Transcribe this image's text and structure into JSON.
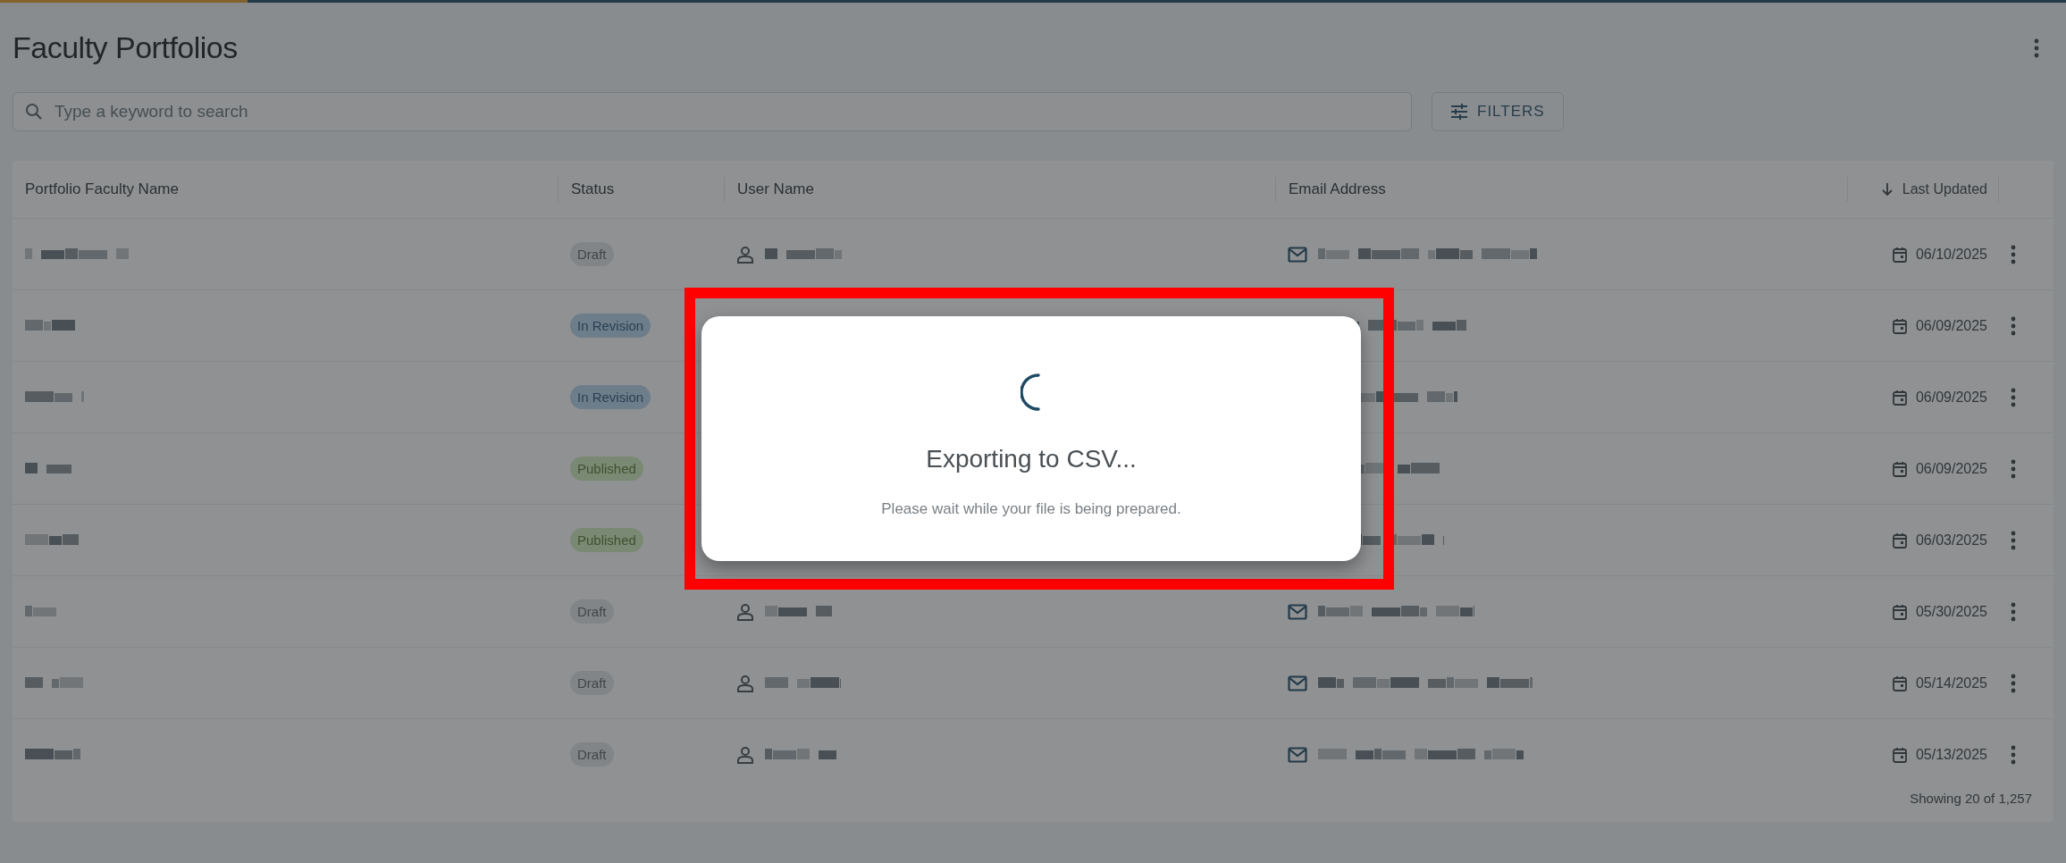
{
  "progress_bar": {
    "level": 0.12
  },
  "page": {
    "title": "Faculty Portfolios"
  },
  "search": {
    "placeholder": "Type a keyword to search"
  },
  "filters_button": {
    "label": "FILTERS"
  },
  "table": {
    "columns": [
      {
        "label": "Portfolio Faculty Name",
        "sorted": false
      },
      {
        "label": "Status",
        "sorted": false
      },
      {
        "label": "User Name",
        "sorted": false
      },
      {
        "label": "Email Address",
        "sorted": false
      },
      {
        "label": "Last Updated",
        "sorted": true
      }
    ],
    "rows": [
      {
        "status": {
          "label": "Draft",
          "kind": "draft"
        },
        "under_dialog": false,
        "last_updated": "06/10/2025"
      },
      {
        "status": {
          "label": "In Revision",
          "kind": "revision"
        },
        "under_dialog": true,
        "last_updated": "06/09/2025"
      },
      {
        "status": {
          "label": "In Revision",
          "kind": "revision"
        },
        "under_dialog": true,
        "last_updated": "06/09/2025"
      },
      {
        "status": {
          "label": "Published",
          "kind": "published"
        },
        "under_dialog": true,
        "last_updated": "06/09/2025"
      },
      {
        "status": {
          "label": "Published",
          "kind": "published"
        },
        "under_dialog": true,
        "last_updated": "06/03/2025"
      },
      {
        "status": {
          "label": "Draft",
          "kind": "draft"
        },
        "under_dialog": false,
        "last_updated": "05/30/2025"
      },
      {
        "status": {
          "label": "Draft",
          "kind": "draft"
        },
        "under_dialog": false,
        "last_updated": "05/14/2025"
      },
      {
        "status": {
          "label": "Draft",
          "kind": "draft"
        },
        "under_dialog": false,
        "last_updated": "05/13/2025"
      }
    ],
    "footer": "Showing 20 of 1,257"
  },
  "dialog": {
    "title": "Exporting to CSV...",
    "message": "Please wait while your file is being prepared."
  }
}
